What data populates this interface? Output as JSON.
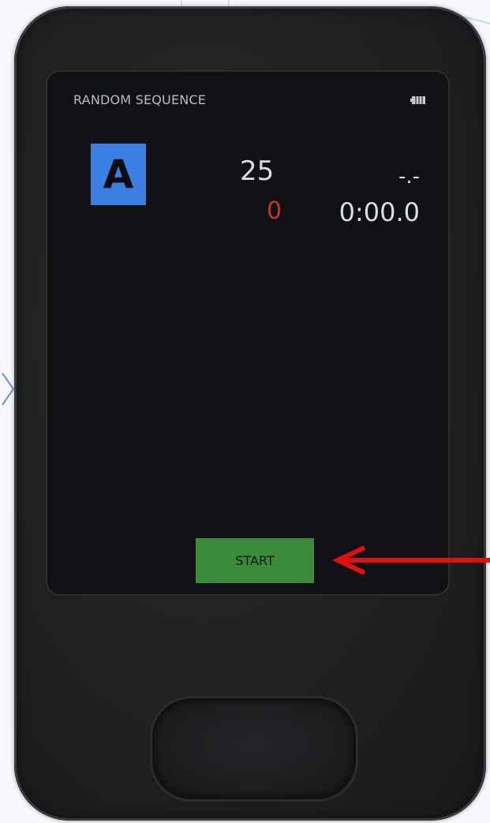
{
  "screen": {
    "title": "RANDOM SEQUENCE",
    "team_letter": "A",
    "count": "25",
    "misses": "0",
    "split": "-.-",
    "elapsed": "0:00.0",
    "start_label": "START"
  },
  "icons": {
    "battery": "battery-icon",
    "back": "back-triangle-icon",
    "home": "home-icon",
    "pointer": "red-arrow-icon",
    "chevron": "chevron-right-icon"
  },
  "colors": {
    "badge": "#3c7fe2",
    "start_button": "#3a8a3a",
    "misses": "#c0392b",
    "arrow": "#e01010",
    "screen_bg": "#0f1114",
    "device_body": "#1f2022"
  }
}
